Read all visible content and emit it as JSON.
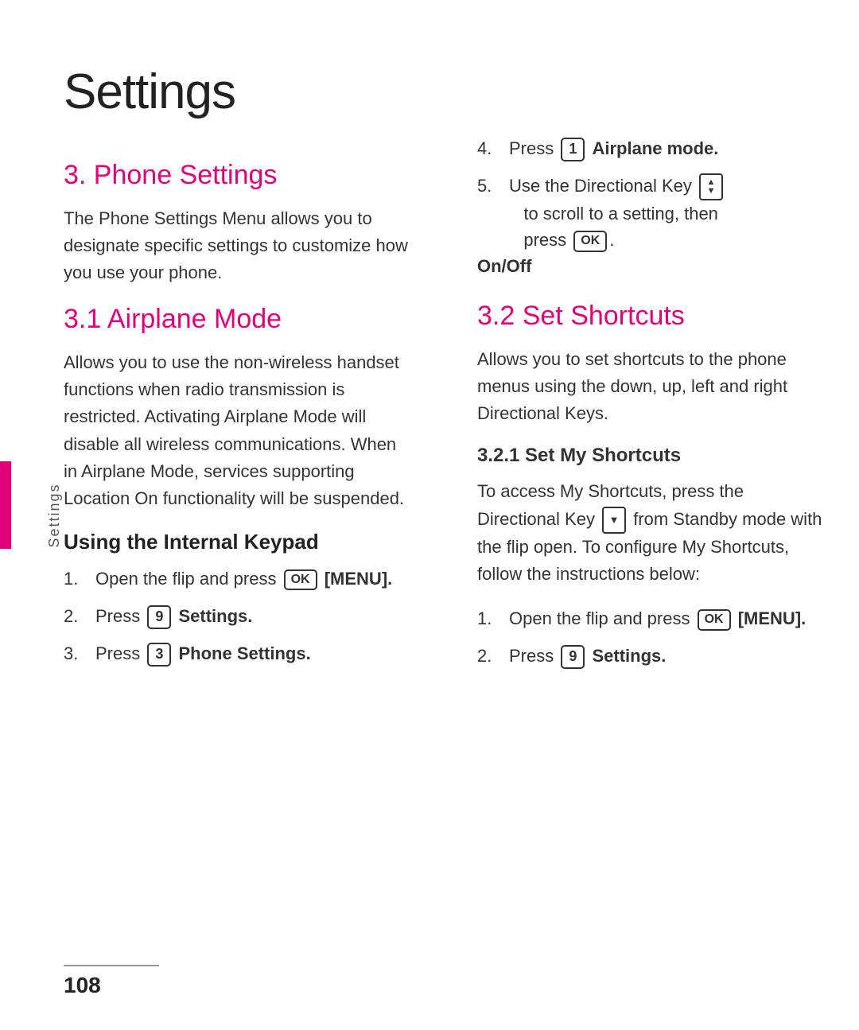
{
  "page": {
    "title": "Settings",
    "sidebar_label": "Settings",
    "page_number": "108"
  },
  "left_column": {
    "section_title": "3. Phone Settings",
    "intro_text": "The Phone Settings Menu allows you to designate specific settings to customize how you use your phone.",
    "subsection_31": {
      "title": "3.1  Airplane Mode",
      "body": "Allows you to use the non-wireless handset functions when radio transmission is restricted. Activating Airplane Mode will disable all wireless communications. When in Airplane Mode, services supporting Location On functionality will be suspended.",
      "sub_heading": "Using the Internal Keypad",
      "steps": [
        {
          "num": "1.",
          "text_before": "Open the flip and press",
          "key": "OK",
          "text_after": "[MENU].",
          "bold_after": true
        },
        {
          "num": "2.",
          "text_before": "Press",
          "key": "9",
          "text_after": "Settings.",
          "bold_after": true
        },
        {
          "num": "3.",
          "text_before": "Press",
          "key": "3",
          "text_after": "Phone Settings.",
          "bold_after": true
        }
      ]
    }
  },
  "right_column": {
    "step4": {
      "num": "4.",
      "text_before": "Press",
      "key": "1",
      "text_after": "Airplane mode.",
      "bold_after": true
    },
    "step5_line1": "5.  Use the Directional Key",
    "step5_line2": "to scroll to a setting, then",
    "step5_line3": "press",
    "step5_key": "OK",
    "on_off_label": "On/Off",
    "section_32": {
      "title": "3.2  Set Shortcuts",
      "body": "Allows you to set shortcuts to the phone menus using the down, up, left and right Directional Keys.",
      "subsection_321": {
        "title": "3.2.1  Set My Shortcuts",
        "body1": "To access My Shortcuts, press the Directional Key",
        "body1_from": "from",
        "body1_rest": "Standby mode with the flip open. To configure My Shortcuts, follow the instructions below:",
        "steps": [
          {
            "num": "1.",
            "text_before": "Open the flip and press",
            "key": "OK",
            "text_after": "[MENU].",
            "bold_after": true
          },
          {
            "num": "2.",
            "text_before": "Press",
            "key": "9",
            "text_after": "Settings.",
            "bold_after": true
          }
        ]
      }
    }
  }
}
